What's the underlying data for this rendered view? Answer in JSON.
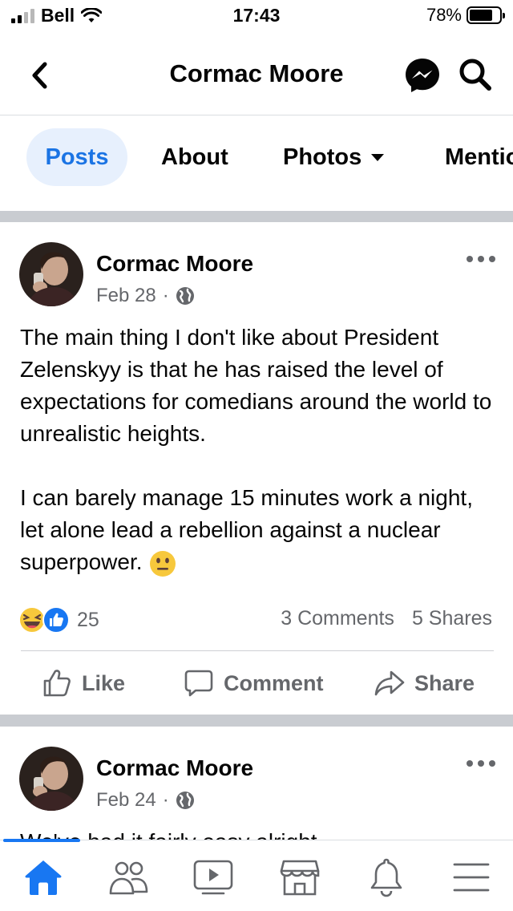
{
  "status_bar": {
    "carrier": "Bell",
    "time": "17:43",
    "battery": "78%",
    "battery_level": 0.78
  },
  "header": {
    "title": "Cormac Moore",
    "back_icon": "chevron-left-icon",
    "messenger_icon": "messenger-icon",
    "search_icon": "search-icon"
  },
  "tabs": [
    {
      "label": "Posts",
      "active": true
    },
    {
      "label": "About",
      "active": false
    },
    {
      "label": "Photos",
      "active": false
    },
    {
      "label": "Mentio",
      "active": false
    }
  ],
  "posts": [
    {
      "author": "Cormac Moore",
      "date": "Feb 28",
      "separator": "·",
      "audience_icon": "globe-icon",
      "paragraph_1": "The main thing I don't like about President Zelenskyy is that he has raised the level of expectations for comedians around the world to unrealistic heights.",
      "paragraph_2": "I can barely manage 15 minutes work a night, let alone lead a rebellion against a nuclear superpower.",
      "emoji": "neutral-face-emoji",
      "reaction_icons": [
        "haha-reaction-icon",
        "like-reaction-icon"
      ],
      "reaction_count": "25",
      "comments": "3 Comments",
      "shares": "5 Shares"
    },
    {
      "author": "Cormac Moore",
      "date": "Feb 24",
      "separator": "·",
      "audience_icon": "globe-icon",
      "text_preview": "We've had it fairly easy alright"
    }
  ],
  "actions": {
    "like": "Like",
    "comment": "Comment",
    "share": "Share"
  },
  "bottom_nav": [
    {
      "icon": "home-icon",
      "active": true
    },
    {
      "icon": "friends-icon",
      "active": false
    },
    {
      "icon": "watch-icon",
      "active": false
    },
    {
      "icon": "marketplace-icon",
      "active": false
    },
    {
      "icon": "notifications-icon",
      "active": false
    },
    {
      "icon": "menu-icon",
      "active": false
    }
  ],
  "colors": {
    "accent": "#1877f2",
    "tab_active_bg": "#e7f0fd",
    "secondary_text": "#65676b",
    "separator": "#c9ccd1"
  }
}
